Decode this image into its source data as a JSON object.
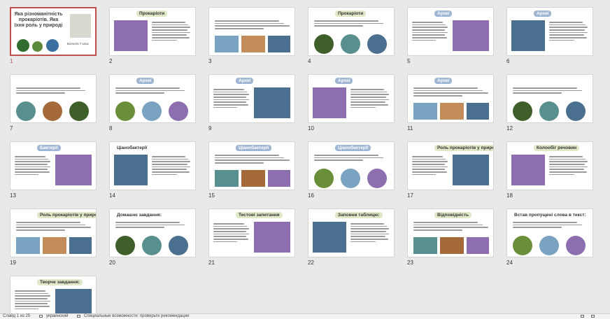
{
  "colors": {
    "selected_border": "#c0504d",
    "green_title": "#dfe9c8",
    "blue_title": "#9fb6d4",
    "background": "#e9e9e9"
  },
  "slides": [
    {
      "num": "1",
      "title": "Яка різноманітність прокаріотів. Яка їхня роль у природі",
      "subtitle": "Біологія 7 клас",
      "style": "title",
      "selected": true
    },
    {
      "num": "2",
      "title": "Прокаріоти",
      "style": "green"
    },
    {
      "num": "3",
      "title": "",
      "style": "text"
    },
    {
      "num": "4",
      "title": "Прокаріоти",
      "style": "green"
    },
    {
      "num": "5",
      "title": "Археї",
      "style": "blue"
    },
    {
      "num": "6",
      "title": "Археї",
      "style": "blue"
    },
    {
      "num": "7",
      "title": "",
      "style": "circles"
    },
    {
      "num": "8",
      "title": "Археї",
      "style": "blue"
    },
    {
      "num": "9",
      "title": "Археї",
      "style": "blue"
    },
    {
      "num": "10",
      "title": "Археї",
      "style": "blue"
    },
    {
      "num": "11",
      "title": "Археї",
      "style": "blue"
    },
    {
      "num": "12",
      "title": "",
      "style": "circles"
    },
    {
      "num": "13",
      "title": "Бактерії",
      "style": "blue"
    },
    {
      "num": "14",
      "title": "Ціанобактерії",
      "style": "plain"
    },
    {
      "num": "15",
      "title": "Ціанобактерії",
      "style": "blue"
    },
    {
      "num": "16",
      "title": "Ціанобактерії",
      "style": "blue"
    },
    {
      "num": "17",
      "title": "Роль прокаріотів у природі",
      "style": "green"
    },
    {
      "num": "18",
      "title": "Колообіг речовин",
      "style": "green"
    },
    {
      "num": "19",
      "title": "Роль прокаріотів у природі",
      "style": "green"
    },
    {
      "num": "20",
      "title": "Домашнє завдання:",
      "style": "plain"
    },
    {
      "num": "21",
      "title": "Тестові запитання",
      "style": "green"
    },
    {
      "num": "22",
      "title": "Заповни таблицю:",
      "style": "green"
    },
    {
      "num": "23",
      "title": "Відповідність",
      "style": "green"
    },
    {
      "num": "24",
      "title": "Встав пропущені слова в текст:",
      "style": "plain"
    },
    {
      "num": "25",
      "title": "Творче завдання:",
      "style": "green"
    }
  ],
  "status": {
    "slide_counter": "Слайд 1 из 25",
    "language": "украинский",
    "accessibility": "Специальные возможности: проверьте рекомендации"
  }
}
